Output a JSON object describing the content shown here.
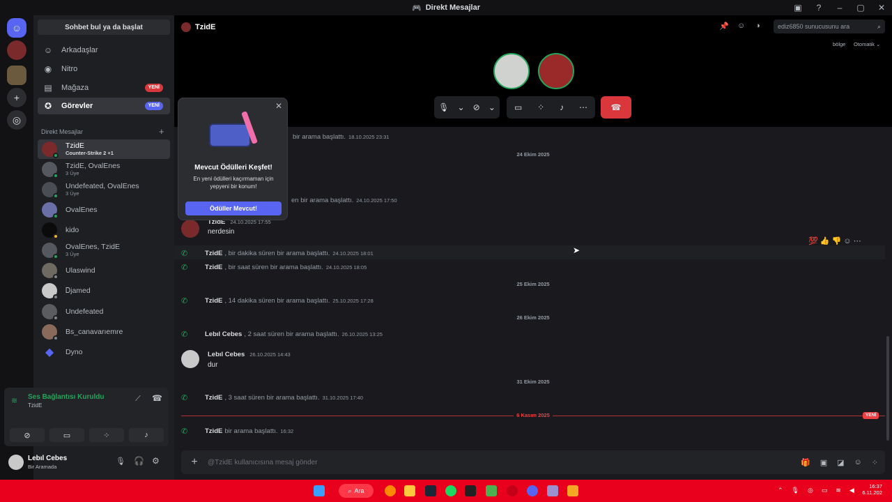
{
  "window": {
    "title": "Direkt Mesajlar"
  },
  "sidebar": {
    "find_button": "Sohbet bul ya da başlat",
    "nav": [
      {
        "label": "Arkadaşlar",
        "icon": "friends-icon"
      },
      {
        "label": "Nitro",
        "icon": "nitro-icon"
      },
      {
        "label": "Mağaza",
        "icon": "shop-icon",
        "badge": "YENİ"
      },
      {
        "label": "Görevler",
        "icon": "quests-icon",
        "badge": "YENİ"
      }
    ],
    "dm_header": "Direkt Mesajlar",
    "dms": [
      {
        "name": "TzidE",
        "sub": "Counter-Strike 2 +1",
        "status": "online"
      },
      {
        "name": "TzidE, OvalEnes",
        "sub": "3 Üye",
        "status": "online"
      },
      {
        "name": "Undefeated, OvalEnes",
        "sub": "3 Üye",
        "status": "online"
      },
      {
        "name": "OvalEnes",
        "sub": "",
        "status": "online"
      },
      {
        "name": "kido",
        "sub": "",
        "status": "idle"
      },
      {
        "name": "OvalEnes, TzidE",
        "sub": "3 Üye",
        "status": "online"
      },
      {
        "name": "Ulaswind",
        "sub": "",
        "status": "off"
      },
      {
        "name": "Ꭰjamed",
        "sub": "",
        "status": "off"
      },
      {
        "name": "Undefeated",
        "sub": "",
        "status": "off"
      },
      {
        "name": "Bs_canavarıemre",
        "sub": "",
        "status": "off"
      },
      {
        "name": "Dyno",
        "sub": "",
        "status": ""
      }
    ]
  },
  "voice": {
    "status": "Ses Bağlantısı Kuruldu",
    "channel": "TzidE"
  },
  "user": {
    "name": "Lebıl Cebes",
    "status": "Bir Aramada"
  },
  "header": {
    "channel": "TzidE",
    "search_placeholder": "ediz6850 sunucusunu ara",
    "region_label": "bölge",
    "region_value": "Otomatik"
  },
  "popup": {
    "title": "Mevcut Ödülleri Keşfet!",
    "body": "En yeni ödülleri kaçırmaman için yepyeni bir konum!",
    "button": "Ödüller Mevcut!"
  },
  "messages": {
    "partial_1": "bir arama başlattı.",
    "partial_1_ts": "18.10.2025 23:31",
    "date_1": "24 Ekim 2025",
    "partial_2": "en bir arama başlattı.",
    "partial_2_ts": "24.10.2025 17:50",
    "msg_author": "TzidE",
    "msg_ts": "24.10.2025 17:55",
    "msg_text": "nerdesin",
    "call_1": {
      "name": "TzidE",
      "text": ", bir dakika süren bir arama başlattı.",
      "ts": "24.10.2025 18:01"
    },
    "call_2": {
      "name": "TzidE",
      "text": ", bir saat süren bir arama başlattı.",
      "ts": "24.10.2025 18:05"
    },
    "date_2": "25 Ekim 2025",
    "call_3": {
      "name": "TzidE",
      "text": ", 14 dakika süren bir arama başlattı.",
      "ts": "25.10.2025 17:28"
    },
    "date_3": "26 Ekim 2025",
    "call_4": {
      "name": "Lebıl Cebes",
      "text": ", 2 saat süren bir arama başlattı.",
      "ts": "26.10.2025 13:25"
    },
    "msg2_author": "Lebıl Cebes",
    "msg2_ts": "26.10.2025 14:43",
    "msg2_text": "dur",
    "date_4": "31 Ekim 2025",
    "call_5": {
      "name": "TzidE",
      "text": ", 3 saat süren bir arama başlattı.",
      "ts": "31.10.2025 17:40"
    },
    "date_5": "6 Kasım 2025",
    "new_badge": "YENİ",
    "call_6": {
      "name": "TzidE",
      "text": " bir arama başlattı.",
      "ts": "16:32"
    }
  },
  "composer": {
    "placeholder": "@TzidE kullanıcısına mesaj gönder"
  },
  "taskbar": {
    "search": "Ara",
    "time": "16:37",
    "date": "6.11.202"
  },
  "colors": {
    "blurple": "#5865f2",
    "red": "#da373c",
    "green": "#23a55a",
    "taskbar": "#e8001c"
  }
}
